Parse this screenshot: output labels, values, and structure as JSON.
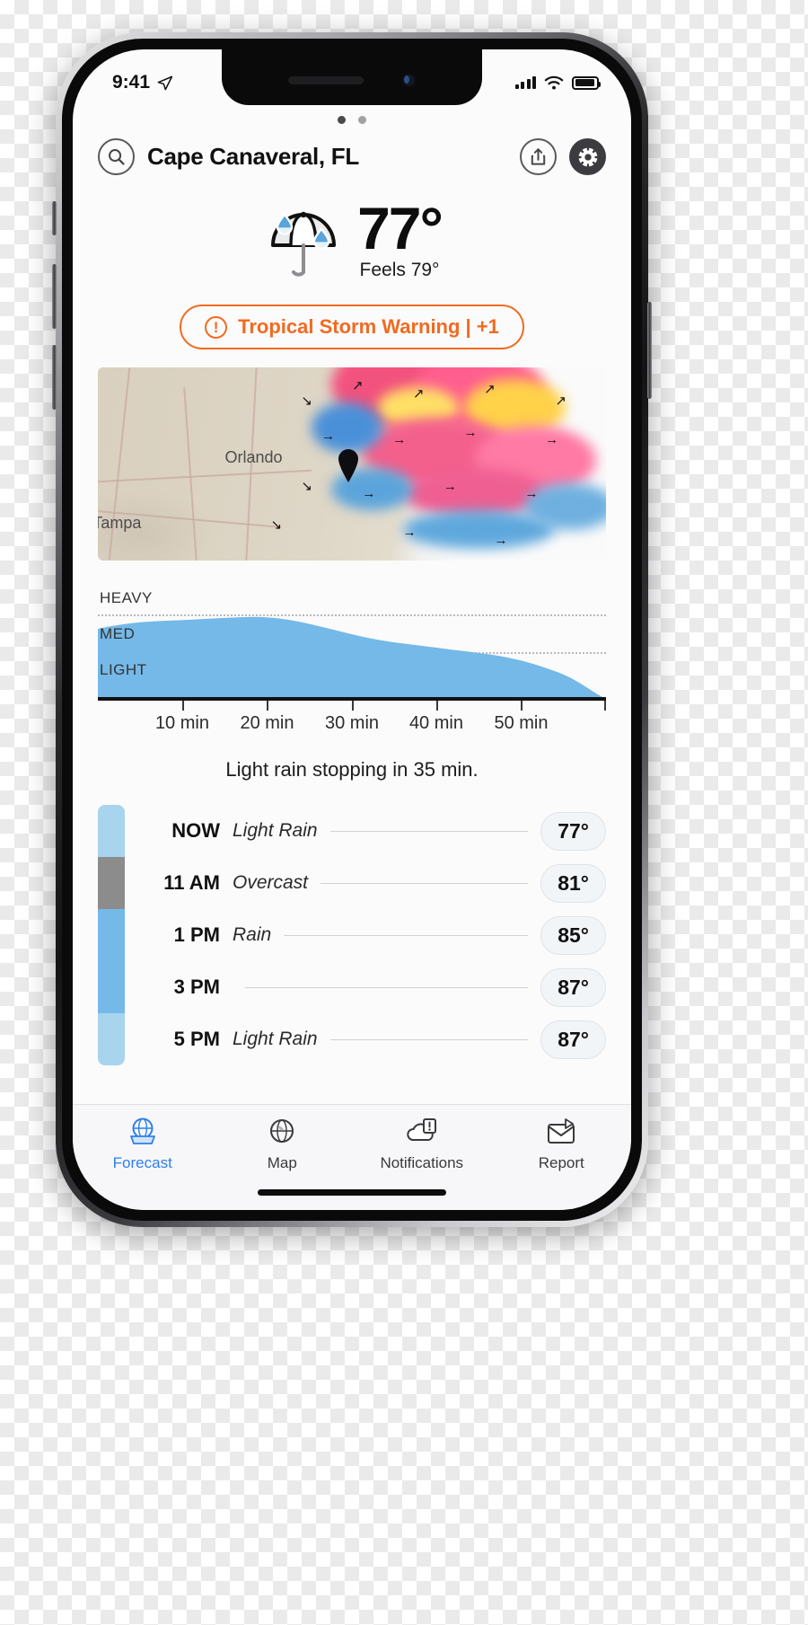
{
  "status_bar": {
    "time": "9:41",
    "location_arrow_icon": "location-arrow-icon",
    "signal_icon": "cellular-signal-icon",
    "wifi_icon": "wifi-icon",
    "battery_icon": "battery-icon"
  },
  "header": {
    "search_icon": "search-icon",
    "location": "Cape Canaveral, FL",
    "share_icon": "share-icon",
    "settings_icon": "gear-icon",
    "page_dots": [
      "active",
      "inactive"
    ]
  },
  "current": {
    "condition_icon": "umbrella-rain-icon",
    "temperature": "77°",
    "feels_like": "Feels 79°"
  },
  "alert": {
    "warning_icon": "exclamation-circle-icon",
    "text": "Tropical Storm Warning | +1",
    "color": "#f26a21"
  },
  "radar": {
    "city_labels": [
      "Orlando",
      "Tampa"
    ],
    "pin_icon": "location-pin-icon",
    "wind_arrow_icon": "wind-arrow-icon"
  },
  "chart_data": {
    "type": "area",
    "title": "",
    "xlabel": "",
    "ylabel": "",
    "intensity_labels": [
      "HEAVY",
      "MED",
      "LIGHT"
    ],
    "x_tick_labels": [
      "10 min",
      "20 min",
      "30 min",
      "40 min",
      "50 min"
    ],
    "x": [
      0,
      5,
      10,
      15,
      20,
      25,
      30,
      35,
      40,
      45,
      50,
      55,
      60
    ],
    "values": [
      0.62,
      0.66,
      0.68,
      0.7,
      0.7,
      0.66,
      0.58,
      0.52,
      0.47,
      0.42,
      0.36,
      0.22,
      0.0
    ],
    "ylim": [
      0,
      1
    ],
    "y_gridlines": [
      0.75,
      0.5
    ],
    "grid": true,
    "legend": "none",
    "series_color": "#74b9e8",
    "summary": "Light rain stopping in 35 min."
  },
  "hourly": {
    "rows": [
      {
        "time": "NOW",
        "condition": "Light Rain",
        "temp": "77°",
        "bar_color": "#a8d4ee"
      },
      {
        "time": "11 AM",
        "condition": "Overcast",
        "temp": "81°",
        "bar_color": "#8c8c8c"
      },
      {
        "time": "1 PM",
        "condition": "Rain",
        "temp": "85°",
        "bar_color": "#74b9e8"
      },
      {
        "time": "3 PM",
        "condition": "",
        "temp": "87°",
        "bar_color": "#74b9e8"
      },
      {
        "time": "5 PM",
        "condition": "Light Rain",
        "temp": "87°",
        "bar_color": "#a8d4ee"
      }
    ]
  },
  "tabbar": {
    "items": [
      {
        "label": "Forecast",
        "icon": "forecast-globe-icon",
        "active": true
      },
      {
        "label": "Map",
        "icon": "map-globe-icon",
        "active": false
      },
      {
        "label": "Notifications",
        "icon": "notification-cloud-icon",
        "active": false
      },
      {
        "label": "Report",
        "icon": "report-envelope-icon",
        "active": false
      }
    ]
  }
}
